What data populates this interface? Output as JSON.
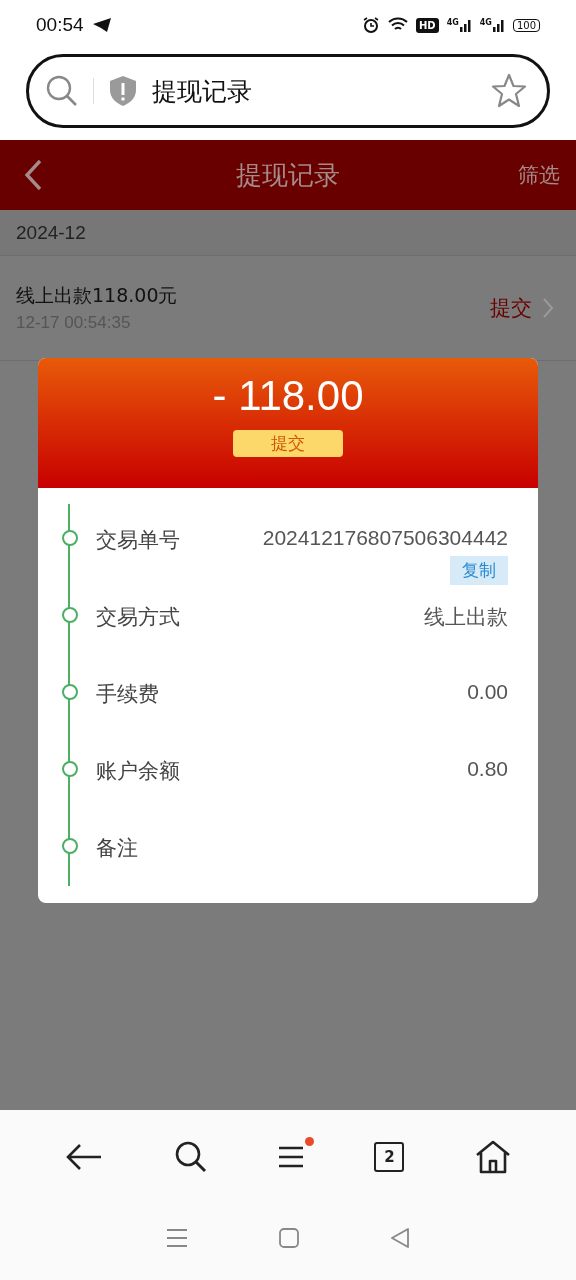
{
  "status_bar": {
    "time": "00:54",
    "hd": "HD",
    "networks": [
      "4G",
      "4G"
    ],
    "battery": "100"
  },
  "address_bar": {
    "text": "提现记录"
  },
  "header": {
    "title": "提现记录",
    "action": "筛选"
  },
  "month": "2024-12",
  "records": [
    {
      "title": "线上出款118.00元",
      "time": "12-17 00:54:35",
      "status": "提交"
    }
  ],
  "dialog": {
    "amount": "- 118.00",
    "status": "提交",
    "rows": [
      {
        "label": "交易单号",
        "value": "202412176807506304442",
        "copy": "复制"
      },
      {
        "label": "交易方式",
        "value": "线上出款"
      },
      {
        "label": "手续费",
        "value": "0.00"
      },
      {
        "label": "账户余额",
        "value": "0.80"
      },
      {
        "label": "备注"
      }
    ]
  },
  "toolbar": {
    "menu_notification": true,
    "tab_count": "2"
  }
}
